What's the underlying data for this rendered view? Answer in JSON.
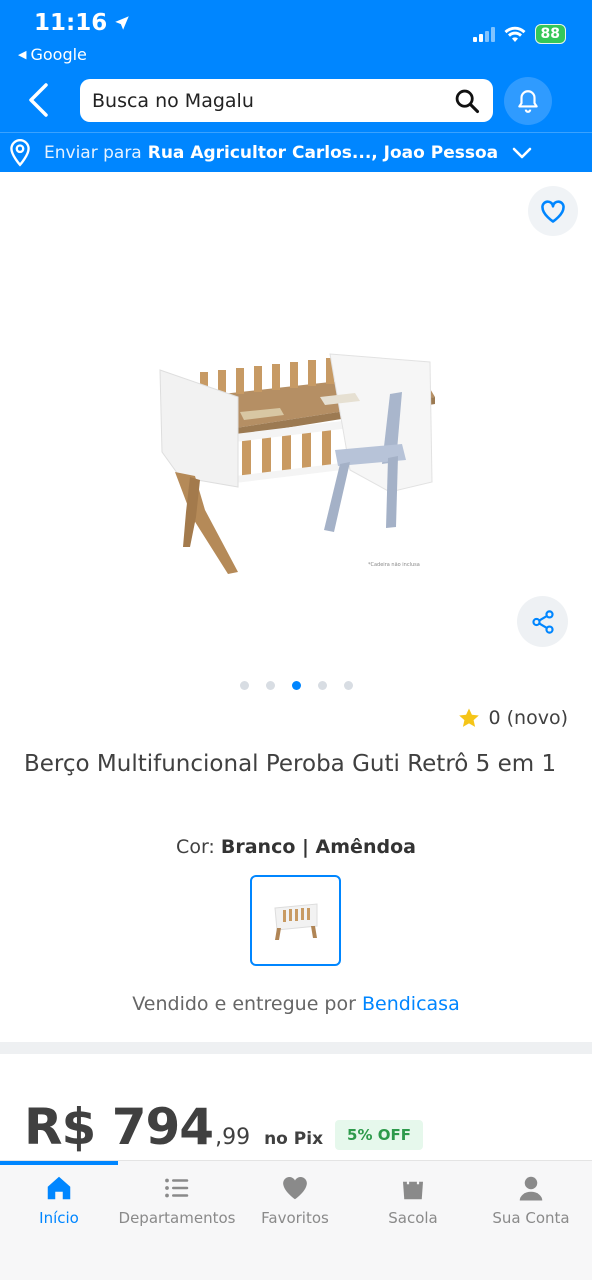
{
  "status_bar": {
    "time": "11:16",
    "back_app": "Google",
    "battery": "88"
  },
  "header": {
    "search_placeholder": "Busca no Magalu",
    "ship_prefix": "Enviar para",
    "ship_address": "Rua Agricultor Carlos..., Joao Pessoa"
  },
  "gallery": {
    "image_count": 5,
    "active_index": 2
  },
  "product": {
    "rating_text": "0 (novo)",
    "title": "Berço Multifuncional Peroba Guti Retrô 5 em 1",
    "color_prefix": "Cor:",
    "color_value": "Branco | Amêndoa",
    "seller_prefix": "Vendido e entregue por",
    "seller_name": "Bendicasa"
  },
  "price": {
    "main": "R$ 794",
    "cents": ",99",
    "method": "no Pix",
    "discount": "5% OFF"
  },
  "tabbar": {
    "items": [
      {
        "label": "Início",
        "icon": "home-icon",
        "active": true
      },
      {
        "label": "Departamentos",
        "icon": "list-icon",
        "active": false
      },
      {
        "label": "Favoritos",
        "icon": "heart-icon",
        "active": false
      },
      {
        "label": "Sacola",
        "icon": "bag-icon",
        "active": false
      },
      {
        "label": "Sua Conta",
        "icon": "user-icon",
        "active": false
      }
    ]
  },
  "colors": {
    "brand_blue": "#0086ff",
    "text": "#404040",
    "discount_green": "#2d9a4b"
  }
}
